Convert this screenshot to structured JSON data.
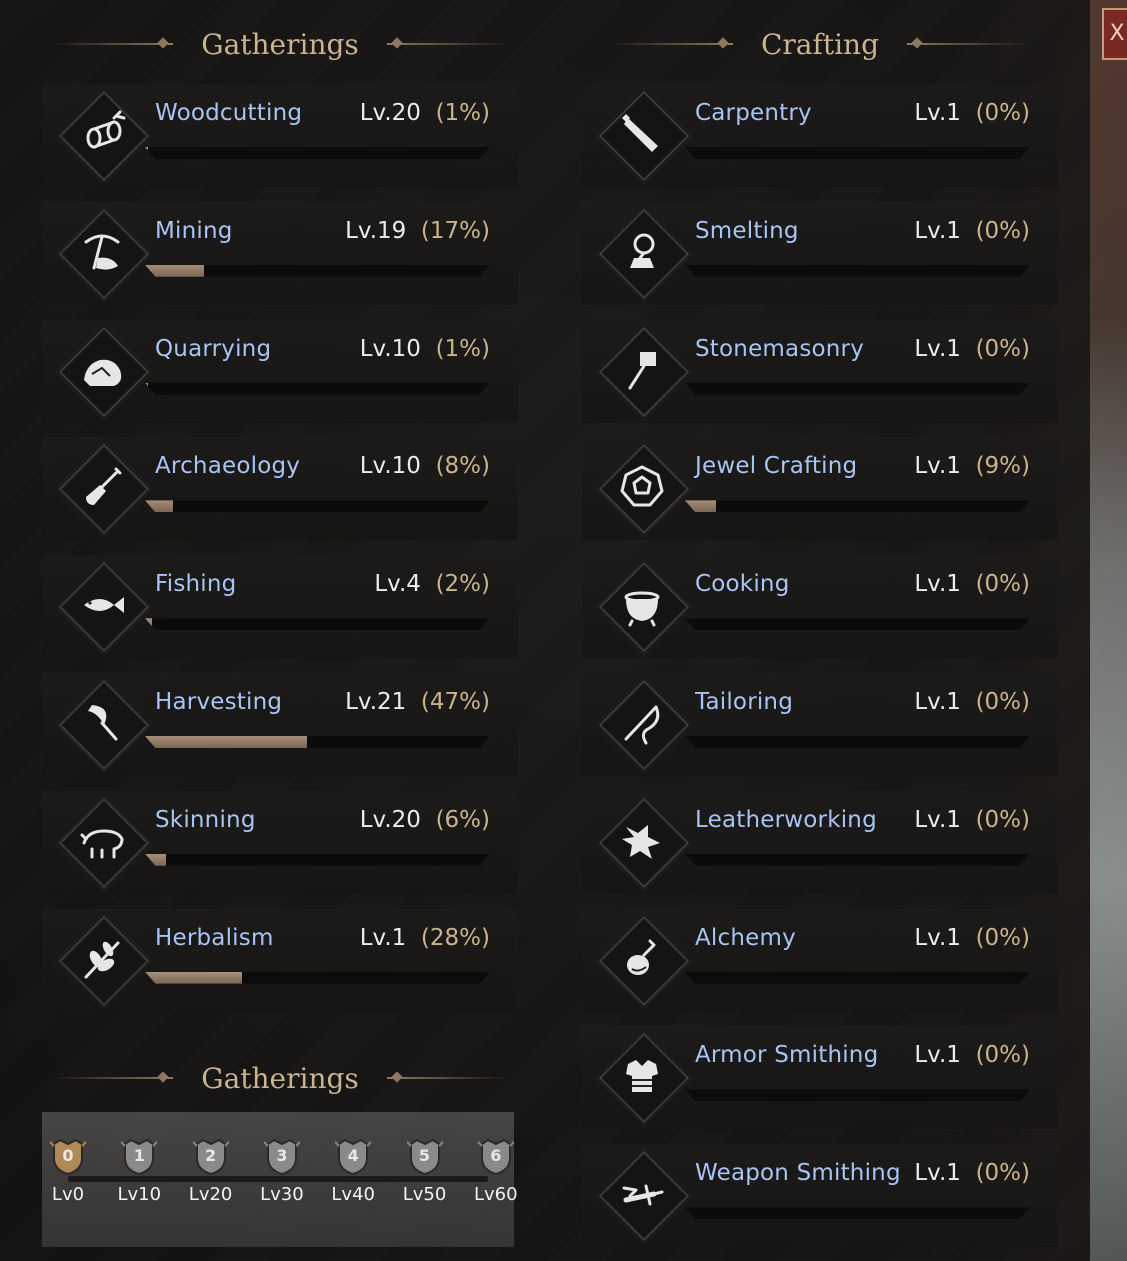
{
  "gatherings_header": "Gatherings",
  "crafting_header": "Crafting",
  "milestones_header": "Gatherings",
  "close_label": "X",
  "gatherings": [
    {
      "name": "Woodcutting",
      "level": "Lv.20",
      "percent": "(1%)",
      "progress": 0.01,
      "icon": "log-icon"
    },
    {
      "name": "Mining",
      "level": "Lv.19",
      "percent": "(17%)",
      "progress": 0.17,
      "icon": "pickaxe-icon"
    },
    {
      "name": "Quarrying",
      "level": "Lv.10",
      "percent": "(1%)",
      "progress": 0.01,
      "icon": "rock-icon"
    },
    {
      "name": "Archaeology",
      "level": "Lv.10",
      "percent": "(8%)",
      "progress": 0.08,
      "icon": "shovel-icon"
    },
    {
      "name": "Fishing",
      "level": "Lv.4",
      "percent": "(2%)",
      "progress": 0.02,
      "icon": "fish-icon"
    },
    {
      "name": "Harvesting",
      "level": "Lv.21",
      "percent": "(47%)",
      "progress": 0.47,
      "icon": "sickle-icon"
    },
    {
      "name": "Skinning",
      "level": "Lv.20",
      "percent": "(6%)",
      "progress": 0.06,
      "icon": "boar-icon"
    },
    {
      "name": "Herbalism",
      "level": "Lv.1",
      "percent": "(28%)",
      "progress": 0.28,
      "icon": "herb-icon"
    }
  ],
  "crafting": [
    {
      "name": "Carpentry",
      "level": "Lv.1",
      "percent": "(0%)",
      "progress": 0,
      "icon": "saw-icon"
    },
    {
      "name": "Smelting",
      "level": "Lv.1",
      "percent": "(0%)",
      "progress": 0,
      "icon": "furnace-icon"
    },
    {
      "name": "Stonemasonry",
      "level": "Lv.1",
      "percent": "(0%)",
      "progress": 0,
      "icon": "hammer-icon"
    },
    {
      "name": "Jewel Crafting",
      "level": "Lv.1",
      "percent": "(9%)",
      "progress": 0.09,
      "icon": "gem-icon"
    },
    {
      "name": "Cooking",
      "level": "Lv.1",
      "percent": "(0%)",
      "progress": 0,
      "icon": "pot-icon"
    },
    {
      "name": "Tailoring",
      "level": "Lv.1",
      "percent": "(0%)",
      "progress": 0,
      "icon": "needle-icon"
    },
    {
      "name": "Leatherworking",
      "level": "Lv.1",
      "percent": "(0%)",
      "progress": 0,
      "icon": "leather-icon"
    },
    {
      "name": "Alchemy",
      "level": "Lv.1",
      "percent": "(0%)",
      "progress": 0,
      "icon": "flask-icon"
    },
    {
      "name": "Armor Smithing",
      "level": "Lv.1",
      "percent": "(0%)",
      "progress": 0,
      "icon": "armor-icon"
    },
    {
      "name": "Weapon Smithing",
      "level": "Lv.1",
      "percent": "(0%)",
      "progress": 0,
      "icon": "sword-icon"
    }
  ],
  "milestones": [
    {
      "num": "0",
      "label": "Lv0",
      "active": true
    },
    {
      "num": "1",
      "label": "Lv10",
      "active": false
    },
    {
      "num": "2",
      "label": "Lv20",
      "active": false
    },
    {
      "num": "3",
      "label": "Lv30",
      "active": false
    },
    {
      "num": "4",
      "label": "Lv40",
      "active": false
    },
    {
      "num": "5",
      "label": "Lv50",
      "active": false
    },
    {
      "num": "6",
      "label": "Lv60",
      "active": false
    }
  ],
  "colors": {
    "skill_name": "#a9c4f2",
    "percent": "#c9b48b",
    "header": "#c8b48f",
    "bar_fill": "#9c8670"
  }
}
